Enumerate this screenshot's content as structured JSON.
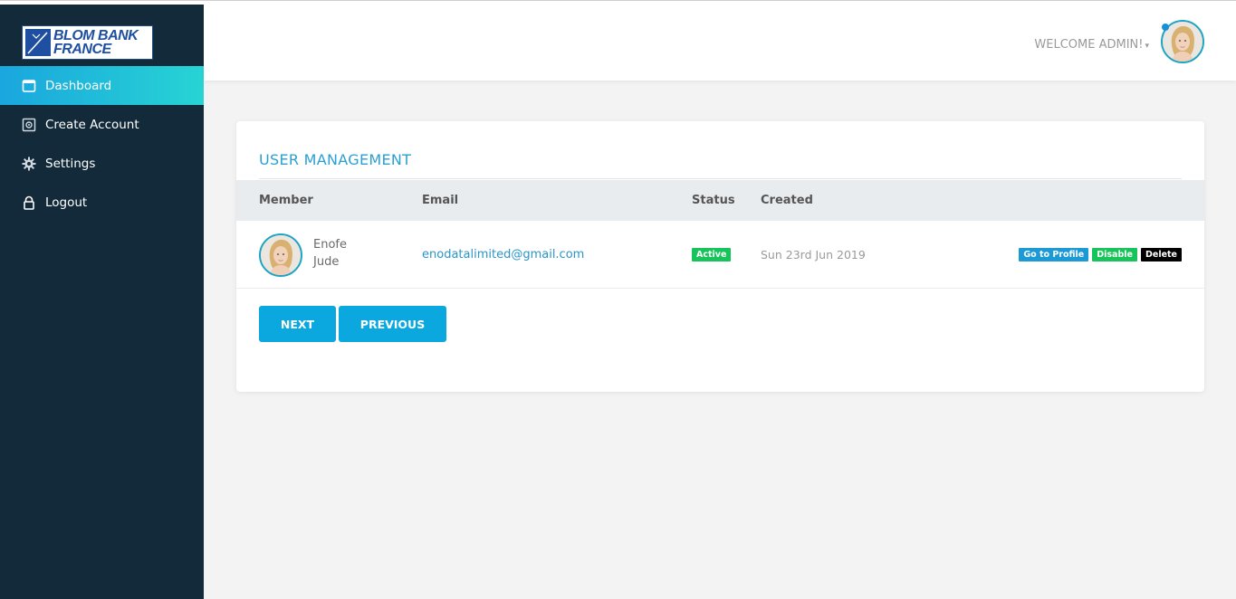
{
  "brand": {
    "line1": "BLOM BANK",
    "line2": "FRANCE"
  },
  "sidebar": {
    "items": [
      {
        "label": "Dashboard",
        "icon": "dashboard-icon"
      },
      {
        "label": "Create Account",
        "icon": "create-account-icon"
      },
      {
        "label": "Settings",
        "icon": "gear-icon"
      },
      {
        "label": "Logout",
        "icon": "lock-icon"
      }
    ]
  },
  "header": {
    "welcome": "WELCOME ADMIN!"
  },
  "panel": {
    "title": "USER MANAGEMENT",
    "columns": [
      "Member",
      "Email",
      "Status",
      "Created"
    ],
    "rows": [
      {
        "first_name": "Enofe",
        "last_name": "Jude",
        "email": "enodatalimited@gmail.com",
        "status": "Active",
        "created": "Sun 23rd Jun 2019",
        "actions": {
          "profile": "Go to Profile",
          "disable": "Disable",
          "delete": "Delete"
        }
      }
    ],
    "pagination": {
      "next": "NEXT",
      "previous": "PREVIOUS"
    }
  },
  "colors": {
    "sidebar_bg": "#132a3a",
    "accent": "#0ba7df",
    "active_gradient_start": "#1aa6de",
    "active_gradient_end": "#27d4d4",
    "status_active": "#16c45a"
  }
}
